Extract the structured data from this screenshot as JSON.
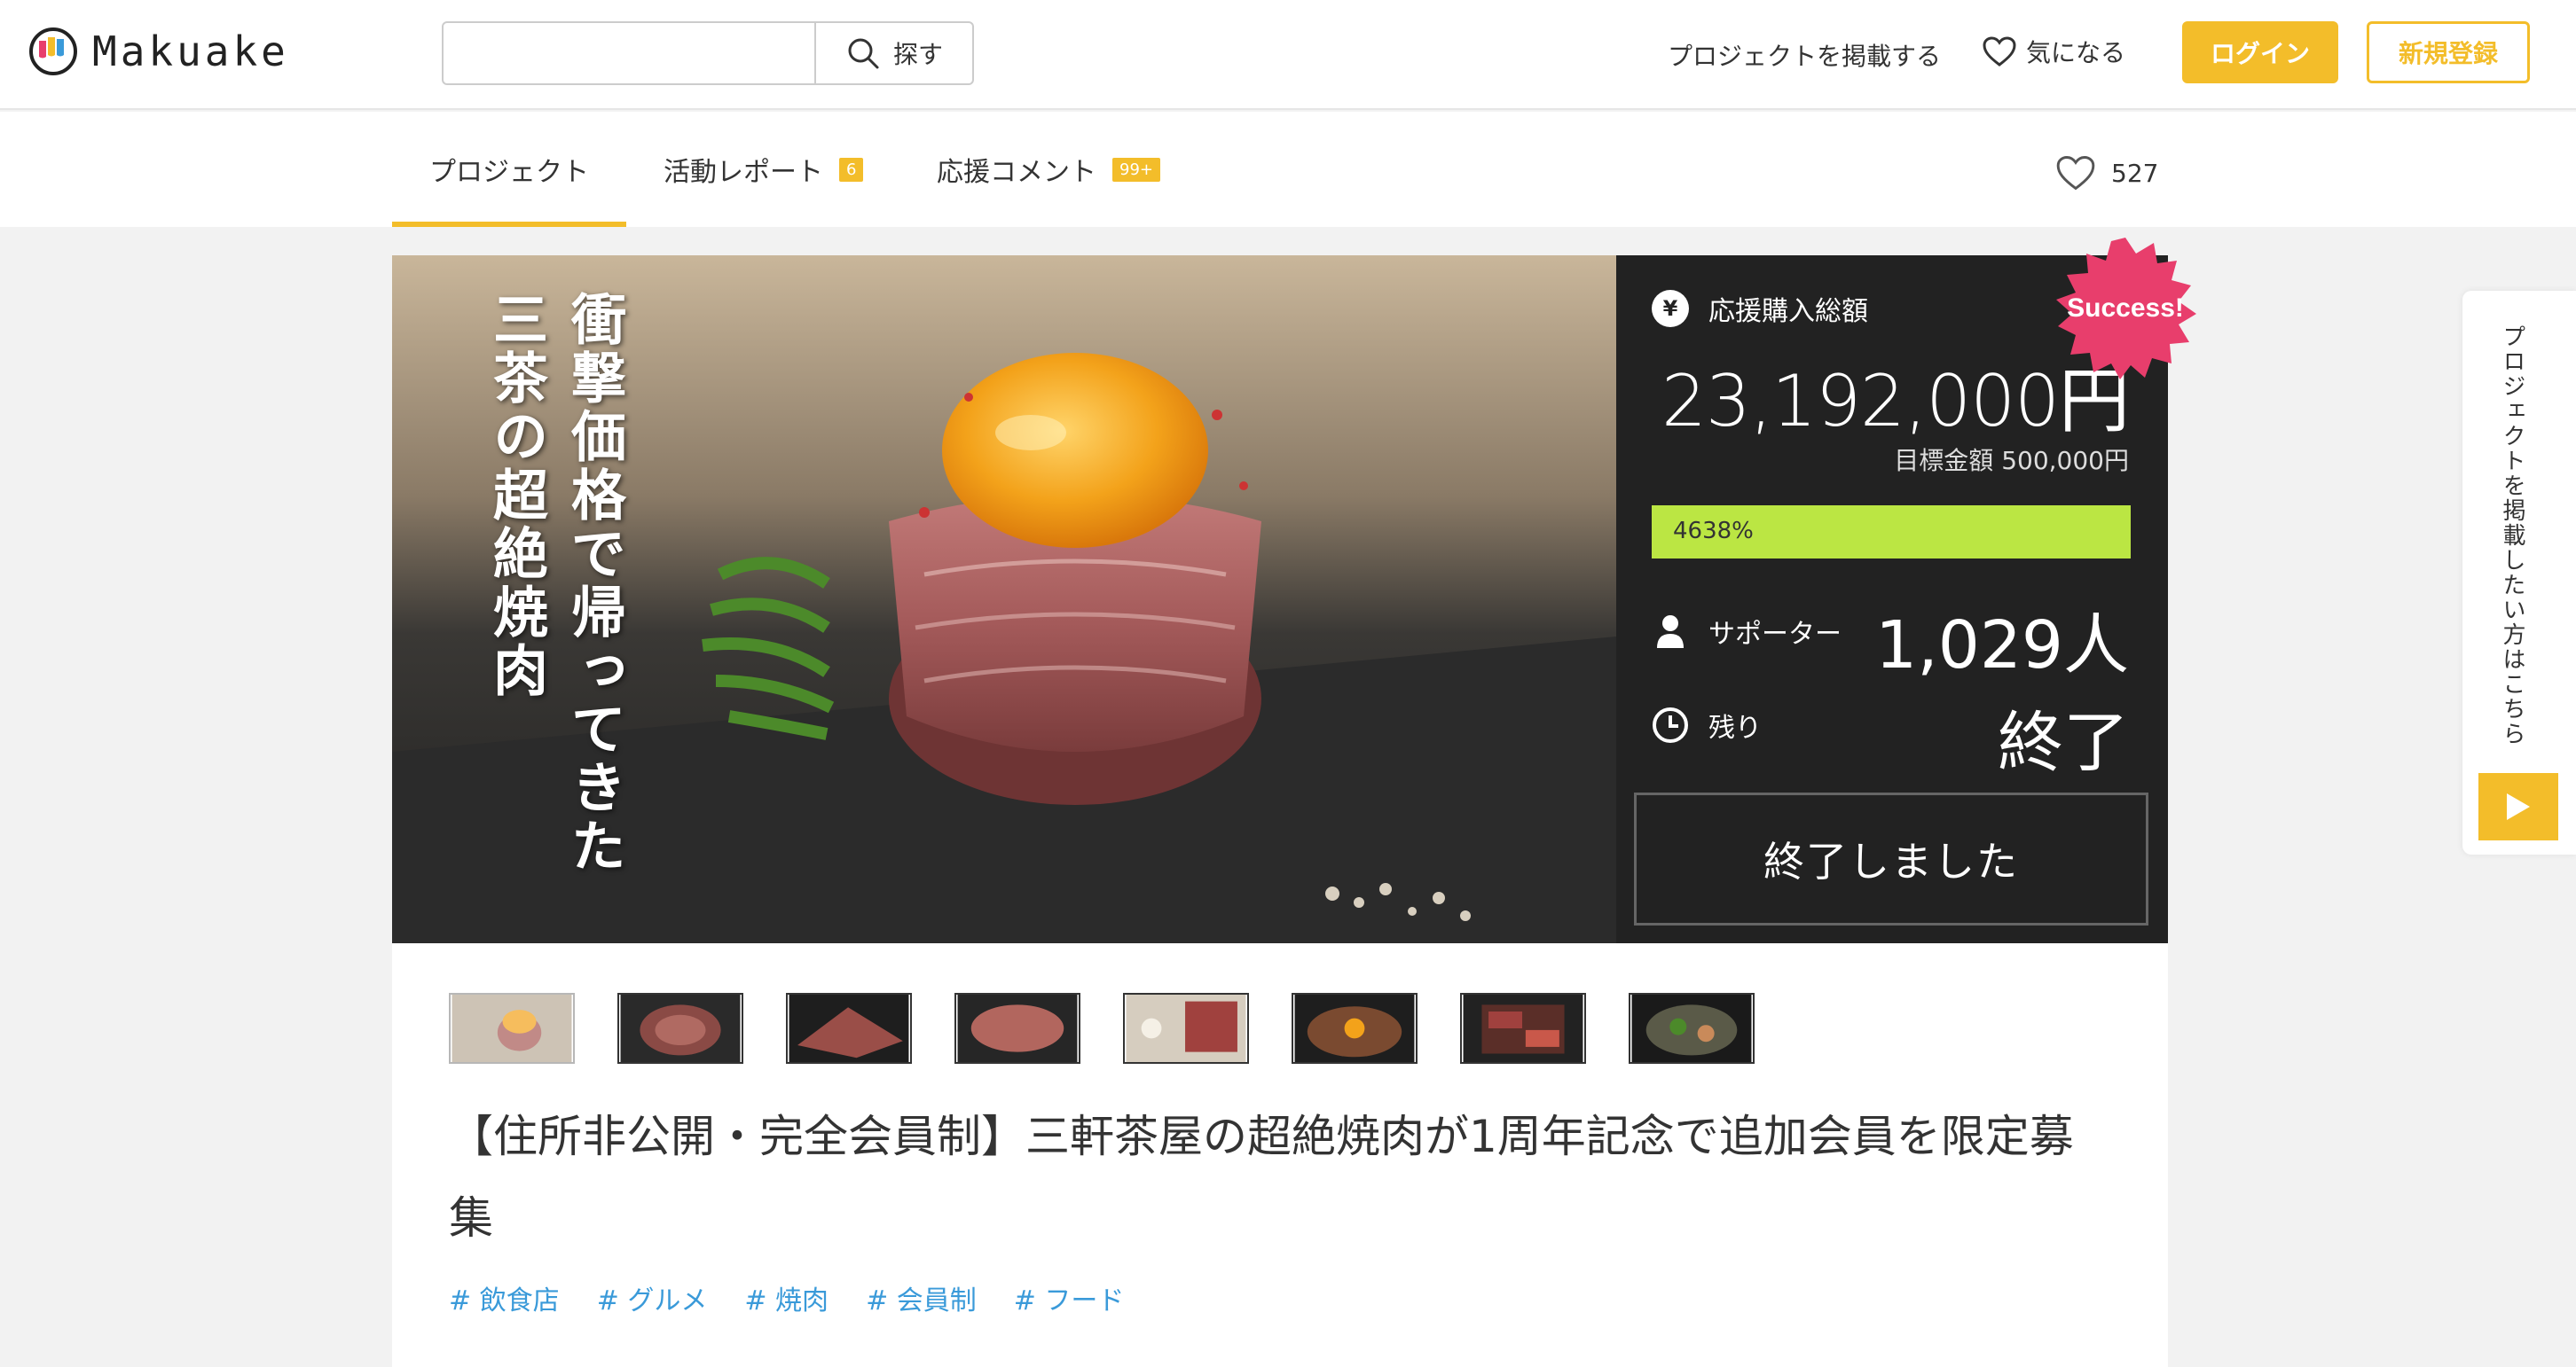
{
  "header": {
    "logo_text": "Makuake",
    "search": {
      "value": "",
      "placeholder": "",
      "button_label": "探す"
    },
    "post_project_label": "プロジェクトを掲載する",
    "favorites_label": "気になる",
    "login_label": "ログイン",
    "signup_label": "新規登録"
  },
  "tabs": [
    {
      "label": "プロジェクト",
      "badge": ""
    },
    {
      "label": "活動レポート",
      "badge": "6"
    },
    {
      "label": "応援コメント",
      "badge": "99+"
    }
  ],
  "like_count": "527",
  "hero": {
    "title_lines": [
      "衝撃価格で帰ってきた",
      "三茶の超絶焼肉"
    ]
  },
  "stats": {
    "badge": "Success!",
    "total_label": "応援購入総額",
    "yen_symbol": "¥",
    "total_amount": "23,192,000円",
    "goal": "目標金額 500,000円",
    "progress_text": "4638%",
    "progress_fraction": 1.0,
    "supporters_label": "サポーター",
    "supporters_value": "1,029人",
    "remaining_label": "残り",
    "remaining_value": "終了",
    "ended_button": "終了しました"
  },
  "project": {
    "title": "【住所非公開・完全会員制】三軒茶屋の超絶焼肉が1周年記念で追加会員を限定募集",
    "tags": [
      "# 飲食店",
      "# グルメ",
      "# 焼肉",
      "# 会員制",
      "# フード"
    ],
    "thumbnails": [
      "thumb-1",
      "thumb-2",
      "thumb-3",
      "thumb-4",
      "thumb-5",
      "thumb-6",
      "thumb-7",
      "thumb-8"
    ]
  },
  "side_widget": {
    "text": "プロジェクトを掲載したい方はこちら"
  },
  "colors": {
    "accent": "#f3bd2a",
    "progress": "#bbe643",
    "success_badge": "#e83e6c",
    "tag": "#3a9ad9"
  }
}
